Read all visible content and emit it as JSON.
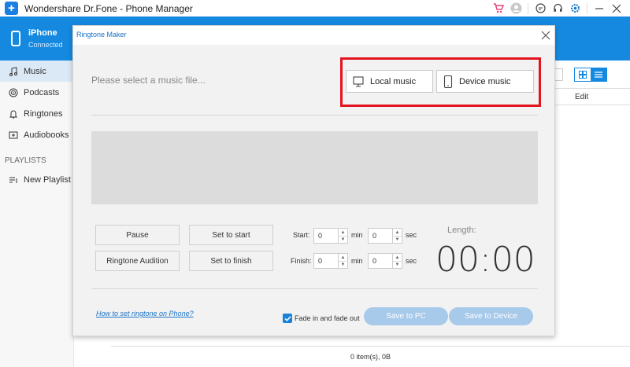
{
  "app": {
    "title": "Wondershare Dr.Fone - Phone Manager",
    "logo": "plus-logo",
    "title_icons": [
      "cart-icon",
      "user-icon",
      "feedback-icon",
      "headset-icon",
      "settings-icon",
      "minimize-icon",
      "close-icon"
    ],
    "accent_color": "#1589e0"
  },
  "device": {
    "name": "iPhone",
    "status": "Connected"
  },
  "sidebar": {
    "items": [
      {
        "label": "Music",
        "icon": "music-note-icon",
        "active": true
      },
      {
        "label": "Podcasts",
        "icon": "podcast-icon",
        "active": false
      },
      {
        "label": "Ringtones",
        "icon": "bell-icon",
        "active": false
      },
      {
        "label": "Audiobooks",
        "icon": "audiobook-icon",
        "active": false
      }
    ],
    "section_label": "PLAYLISTS",
    "playlist_item": {
      "label": "New Playlist",
      "icon": "playlist-icon"
    }
  },
  "right_panel": {
    "column_edit": "Edit",
    "view_modes": [
      "grid-view-icon",
      "list-view-icon"
    ]
  },
  "status_bar": {
    "text": "0 item(s), 0B"
  },
  "modal": {
    "title": "Ringtone Maker",
    "prompt": "Please select a music file...",
    "local_music_label": "Local music",
    "device_music_label": "Device music",
    "highlight_color": "#e3141f",
    "pause_label": "Pause",
    "audition_label": "Ringtone Audition",
    "set_start_label": "Set to start",
    "set_finish_label": "Set to finish",
    "start_label": "Start:",
    "finish_label": "Finish:",
    "start_min": "0",
    "start_sec": "0",
    "finish_min": "0",
    "finish_sec": "0",
    "min_unit": "min",
    "sec_unit": "sec",
    "length_label": "Length:",
    "length_value": "00:00",
    "help_link": "How to set ringtone on Phone?",
    "fade_label": "Fade in and fade out",
    "fade_checked": true,
    "save_pc_label": "Save to PC",
    "save_device_label": "Save to Device"
  }
}
